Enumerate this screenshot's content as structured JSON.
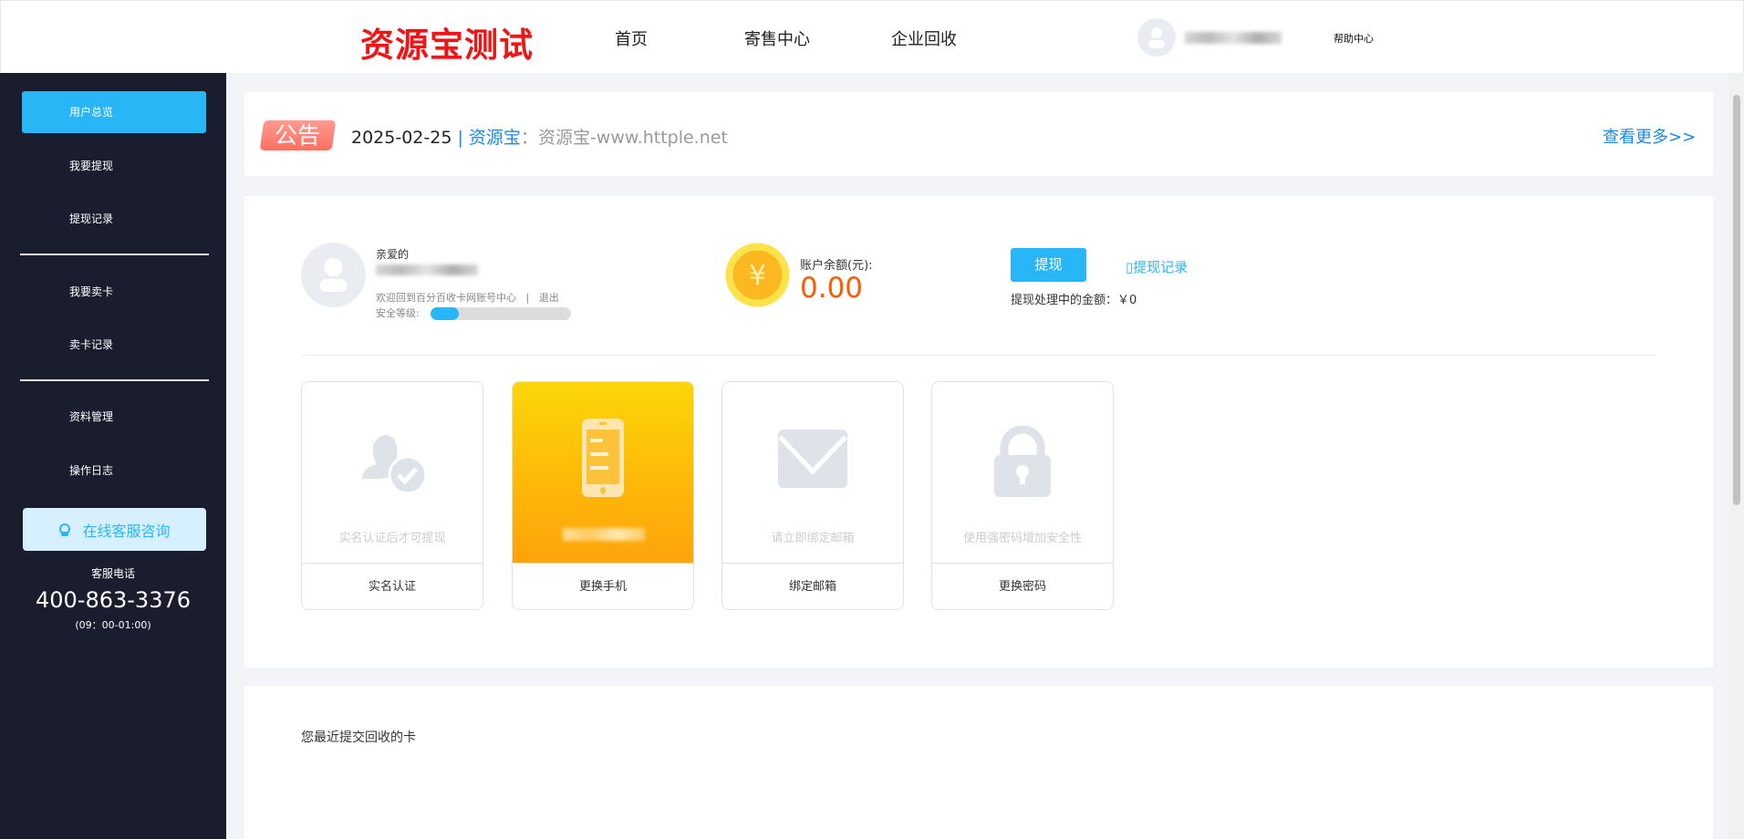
{
  "header": {
    "logo": "资源宝测试",
    "nav": [
      "首页",
      "寄售中心",
      "企业回收"
    ],
    "help": "帮助中心"
  },
  "sidebar": {
    "items": [
      "用户总览",
      "我要提现",
      "提现记录",
      "我要卖卡",
      "卖卡记录",
      "资料管理",
      "操作日志"
    ],
    "service_btn": "在线客服咨询",
    "phone_label": "客服电话",
    "phone": "400-863-3376",
    "hours": "(09：00-01:00)"
  },
  "notice": {
    "badge": "公告",
    "date": "2025-02-25",
    "sep": " | ",
    "source": "资源宝",
    "colon": "：",
    "content": "资源宝-www.httple.net",
    "more": "查看更多>>"
  },
  "user": {
    "greeting": "亲爱的",
    "welcome": "欢迎回到百分百收卡网账号中心",
    "divider": "|",
    "logout": "退出",
    "security_label": "安全等级:",
    "security_level": 0.2
  },
  "balance": {
    "label": "账户余额(元):",
    "value": "0.00",
    "withdraw": "提现",
    "records": "提现记录",
    "pending": "提现处理中的金额：￥0"
  },
  "cards": [
    {
      "desc": "实名认证后才可提现",
      "label": "实名认证"
    },
    {
      "desc": "",
      "label": "更换手机"
    },
    {
      "desc": "请立即绑定邮箱",
      "label": "绑定邮箱"
    },
    {
      "desc": "使用强密码增加安全性",
      "label": "更换密码"
    }
  ],
  "recent": {
    "title": "您最近提交回收的卡"
  },
  "colors": {
    "accent": "#29b6f6",
    "brand": "#f01414",
    "sidebar": "#1a1d2e",
    "balance": "#ff5a00"
  }
}
